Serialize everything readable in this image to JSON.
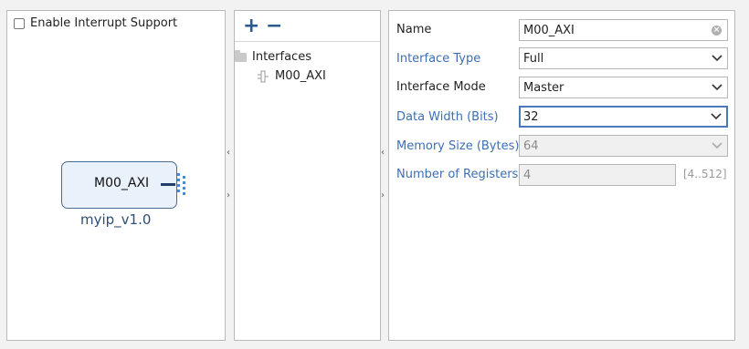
{
  "left": {
    "checkbox_label": "Enable Interrupt Support",
    "block_port_label": "M00_AXI",
    "block_name": "myip_v1.0"
  },
  "middle": {
    "add_icon": "plus-icon",
    "remove_icon": "minus-icon",
    "tree_root_label": "Interfaces",
    "tree_child_label": "M00_AXI"
  },
  "right": {
    "name_label": "Name",
    "name_value": "M00_AXI",
    "interface_type_label": "Interface Type",
    "interface_type_value": "Full",
    "interface_mode_label": "Interface Mode",
    "interface_mode_value": "Master",
    "data_width_label": "Data Width (Bits)",
    "data_width_value": "32",
    "memory_size_label": "Memory Size (Bytes)",
    "memory_size_value": "64",
    "num_registers_label": "Number of Registers",
    "num_registers_value": "4",
    "num_registers_range": "[4..512]"
  },
  "colors": {
    "accent_blue": "#3c6fb5",
    "block_fill": "#e9f1fb",
    "block_border": "#4d6b8c"
  }
}
